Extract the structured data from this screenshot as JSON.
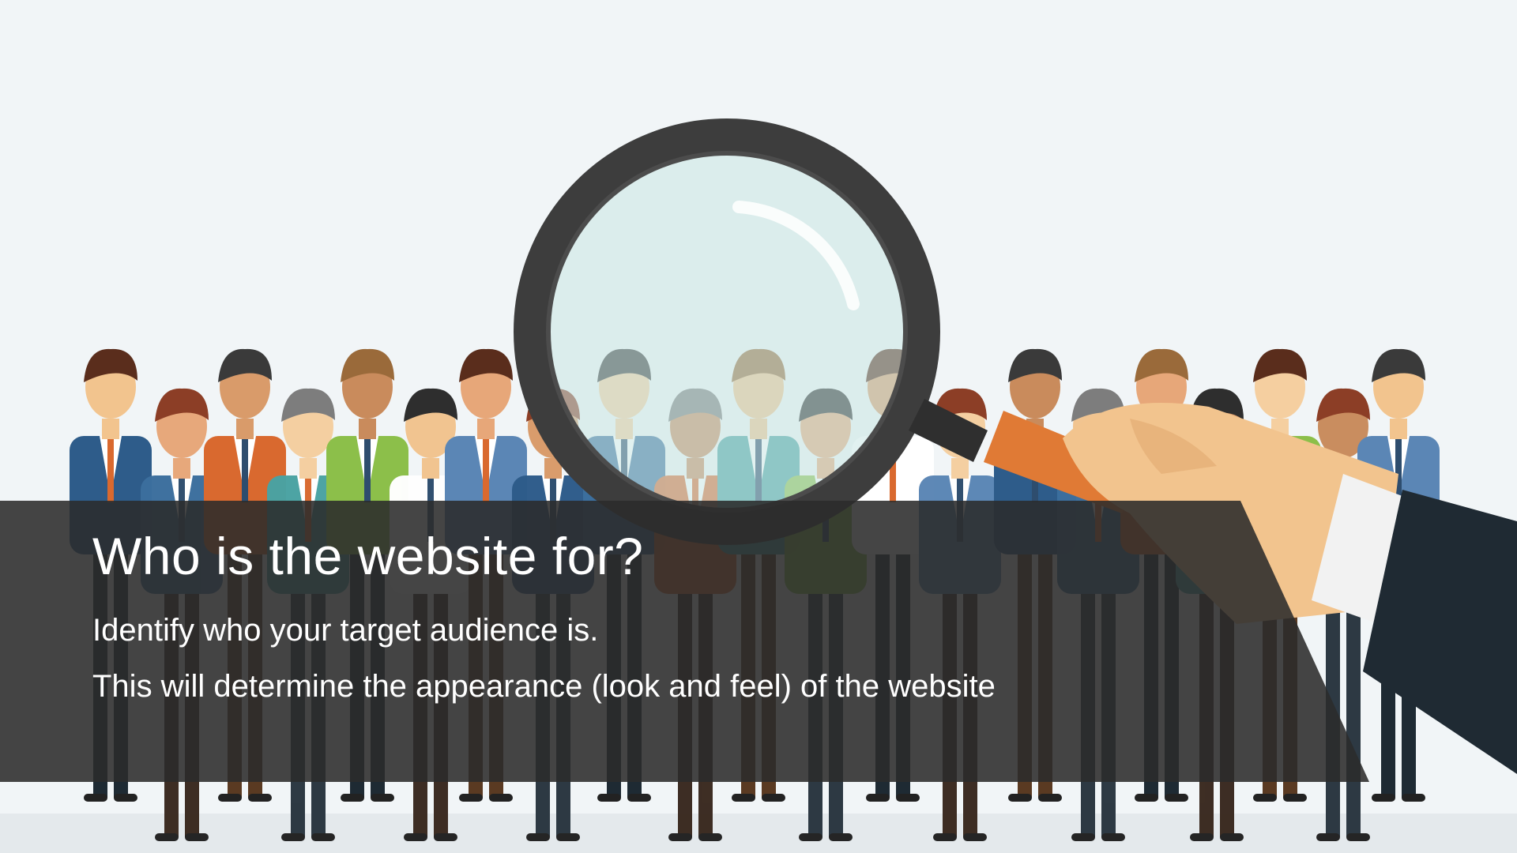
{
  "slide": {
    "title": "Who is the website for?",
    "lines": [
      "Identify who your target audience is.",
      "This will determine the appearance (look and feel) of the website"
    ]
  },
  "illustration": {
    "subject": "crowd-of-people",
    "tool_icon": "magnifying-glass-icon",
    "colors": {
      "background": "#f1f5f7",
      "overlay": "#2b2b2b",
      "lens_rim": "#3d3d3d",
      "lens_glass": "#c8e6e3",
      "handle": "#e07a35",
      "hand": "#f2c48e",
      "sleeve": "#1f2a33",
      "cuff": "#f2f2f2"
    }
  }
}
